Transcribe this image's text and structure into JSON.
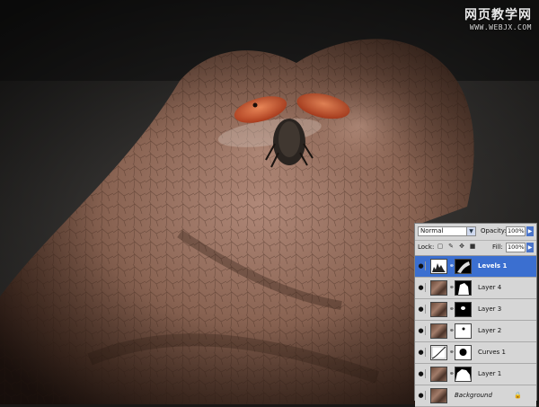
{
  "watermark": {
    "site_name": "网页教学网",
    "url": "WWW.WEBJX.COM"
  },
  "colors": {
    "panel_bg": "#d6d6d6",
    "selected_layer": "#3b6fd0",
    "button_blue": "#4a74c9"
  },
  "layers_panel": {
    "blend_mode": "Normal",
    "opacity_label": "Opacity:",
    "opacity_value": "100%",
    "lock_label": "Lock:",
    "lock_icons": [
      "lock-transparency-icon",
      "lock-brush-icon",
      "lock-move-icon",
      "lock-all-icon"
    ],
    "fill_label": "Fill:",
    "fill_value": "100%",
    "layers": [
      {
        "name": "Levels 1",
        "selected": true,
        "thumb": "levels-adjustment-icon",
        "mask": "mask-thumbnail"
      },
      {
        "name": "Layer 4",
        "selected": false,
        "thumb": "photo-thumbnail",
        "mask": "mask-thumbnail"
      },
      {
        "name": "Layer 3",
        "selected": false,
        "thumb": "photo-thumbnail",
        "mask": "mask-thumbnail"
      },
      {
        "name": "Layer 2",
        "selected": false,
        "thumb": "photo-thumbnail",
        "mask": "mask-thumbnail"
      },
      {
        "name": "Curves 1",
        "selected": false,
        "thumb": "curves-adjustment-icon",
        "mask": "mask-thumbnail"
      },
      {
        "name": "Layer 1",
        "selected": false,
        "thumb": "photo-thumbnail",
        "mask": "mask-thumbnail"
      },
      {
        "name": "Background",
        "selected": false,
        "thumb": "photo-thumbnail",
        "locked": true
      }
    ]
  }
}
